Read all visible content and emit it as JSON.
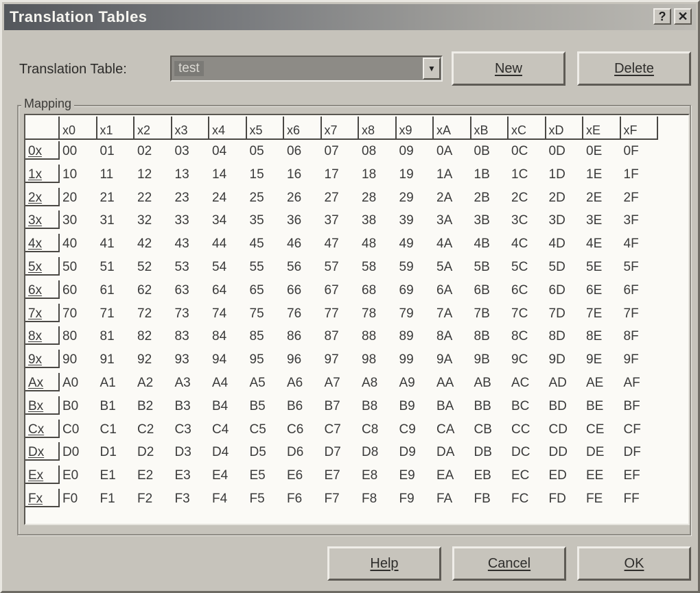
{
  "window": {
    "title": "Translation Tables",
    "help_glyph": "?",
    "close_glyph": "✕"
  },
  "table_selector": {
    "label": "Translation Table:",
    "value": "test",
    "arrow_icon": "chevron-down-icon"
  },
  "buttons": {
    "new": "New",
    "delete": "Delete",
    "help": "Help",
    "cancel": "Cancel",
    "ok": "OK"
  },
  "mapping": {
    "label": "Mapping",
    "columns": [
      "x0",
      "x1",
      "x2",
      "x3",
      "x4",
      "x5",
      "x6",
      "x7",
      "x8",
      "x9",
      "xA",
      "xB",
      "xC",
      "xD",
      "xE",
      "xF"
    ],
    "rows": [
      {
        "label": "0x",
        "values": [
          "00",
          "01",
          "02",
          "03",
          "04",
          "05",
          "06",
          "07",
          "08",
          "09",
          "0A",
          "0B",
          "0C",
          "0D",
          "0E",
          "0F"
        ]
      },
      {
        "label": "1x",
        "values": [
          "10",
          "11",
          "12",
          "13",
          "14",
          "15",
          "16",
          "17",
          "18",
          "19",
          "1A",
          "1B",
          "1C",
          "1D",
          "1E",
          "1F"
        ]
      },
      {
        "label": "2x",
        "values": [
          "20",
          "21",
          "22",
          "23",
          "24",
          "25",
          "26",
          "27",
          "28",
          "29",
          "2A",
          "2B",
          "2C",
          "2D",
          "2E",
          "2F"
        ]
      },
      {
        "label": "3x",
        "values": [
          "30",
          "31",
          "32",
          "33",
          "34",
          "35",
          "36",
          "37",
          "38",
          "39",
          "3A",
          "3B",
          "3C",
          "3D",
          "3E",
          "3F"
        ]
      },
      {
        "label": "4x",
        "values": [
          "40",
          "41",
          "42",
          "43",
          "44",
          "45",
          "46",
          "47",
          "48",
          "49",
          "4A",
          "4B",
          "4C",
          "4D",
          "4E",
          "4F"
        ]
      },
      {
        "label": "5x",
        "values": [
          "50",
          "51",
          "52",
          "53",
          "54",
          "55",
          "56",
          "57",
          "58",
          "59",
          "5A",
          "5B",
          "5C",
          "5D",
          "5E",
          "5F"
        ]
      },
      {
        "label": "6x",
        "values": [
          "60",
          "61",
          "62",
          "63",
          "64",
          "65",
          "66",
          "67",
          "68",
          "69",
          "6A",
          "6B",
          "6C",
          "6D",
          "6E",
          "6F"
        ]
      },
      {
        "label": "7x",
        "values": [
          "70",
          "71",
          "72",
          "73",
          "74",
          "75",
          "76",
          "77",
          "78",
          "79",
          "7A",
          "7B",
          "7C",
          "7D",
          "7E",
          "7F"
        ]
      },
      {
        "label": "8x",
        "values": [
          "80",
          "81",
          "82",
          "83",
          "84",
          "85",
          "86",
          "87",
          "88",
          "89",
          "8A",
          "8B",
          "8C",
          "8D",
          "8E",
          "8F"
        ]
      },
      {
        "label": "9x",
        "values": [
          "90",
          "91",
          "92",
          "93",
          "94",
          "95",
          "96",
          "97",
          "98",
          "99",
          "9A",
          "9B",
          "9C",
          "9D",
          "9E",
          "9F"
        ]
      },
      {
        "label": "Ax",
        "values": [
          "A0",
          "A1",
          "A2",
          "A3",
          "A4",
          "A5",
          "A6",
          "A7",
          "A8",
          "A9",
          "AA",
          "AB",
          "AC",
          "AD",
          "AE",
          "AF"
        ]
      },
      {
        "label": "Bx",
        "values": [
          "B0",
          "B1",
          "B2",
          "B3",
          "B4",
          "B5",
          "B6",
          "B7",
          "B8",
          "B9",
          "BA",
          "BB",
          "BC",
          "BD",
          "BE",
          "BF"
        ]
      },
      {
        "label": "Cx",
        "values": [
          "C0",
          "C1",
          "C2",
          "C3",
          "C4",
          "C5",
          "C6",
          "C7",
          "C8",
          "C9",
          "CA",
          "CB",
          "CC",
          "CD",
          "CE",
          "CF"
        ]
      },
      {
        "label": "Dx",
        "values": [
          "D0",
          "D1",
          "D2",
          "D3",
          "D4",
          "D5",
          "D6",
          "D7",
          "D8",
          "D9",
          "DA",
          "DB",
          "DC",
          "DD",
          "DE",
          "DF"
        ]
      },
      {
        "label": "Ex",
        "values": [
          "E0",
          "E1",
          "E2",
          "E3",
          "E4",
          "E5",
          "E6",
          "E7",
          "E8",
          "E9",
          "EA",
          "EB",
          "EC",
          "ED",
          "EE",
          "EF"
        ]
      },
      {
        "label": "Fx",
        "values": [
          "F0",
          "F1",
          "F2",
          "F3",
          "F4",
          "F5",
          "F6",
          "F7",
          "F8",
          "F9",
          "FA",
          "FB",
          "FC",
          "FD",
          "FE",
          "FF"
        ]
      }
    ]
  }
}
